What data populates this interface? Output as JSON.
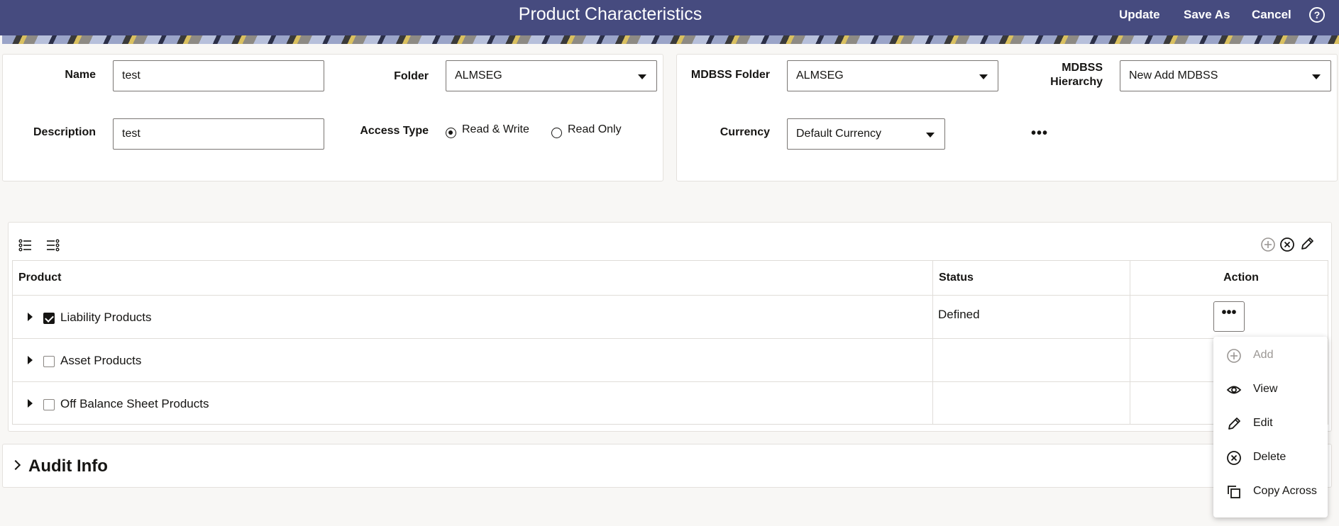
{
  "header": {
    "title": "Product Characteristics",
    "update_label": "Update",
    "save_as_label": "Save As",
    "cancel_label": "Cancel",
    "help_symbol": "?"
  },
  "left_panel": {
    "name_label": "Name",
    "name_value": "test",
    "folder_label": "Folder",
    "folder_value": "ALMSEG",
    "description_label": "Description",
    "description_value": "test",
    "access_type_label": "Access Type",
    "access_options": [
      "Read & Write",
      "Read Only"
    ],
    "access_selected": "Read & Write"
  },
  "right_panel": {
    "mdbss_folder_label": "MDBSS Folder",
    "mdbss_folder_value": "ALMSEG",
    "mdbss_hierarchy_label_line1": "MDBSS",
    "mdbss_hierarchy_label_line2": "Hierarchy",
    "mdbss_hierarchy_value": "New Add MDBSS",
    "currency_label": "Currency",
    "currency_value": "Default Currency",
    "more_symbol": "•••"
  },
  "grid": {
    "columns": [
      "Product",
      "Status",
      "Action"
    ],
    "rows": [
      {
        "product": "Liability Products",
        "checked": true,
        "status": "Defined"
      },
      {
        "product": "Asset Products",
        "checked": false,
        "status": ""
      },
      {
        "product": "Off Balance Sheet Products",
        "checked": false,
        "status": ""
      }
    ],
    "action_symbol": "•••"
  },
  "action_menu": {
    "items": [
      {
        "label": "Add",
        "icon": "plus-circle-icon",
        "enabled": false
      },
      {
        "label": "View",
        "icon": "eye-icon",
        "enabled": true
      },
      {
        "label": "Edit",
        "icon": "pencil-icon",
        "enabled": true
      },
      {
        "label": "Delete",
        "icon": "x-circle-icon",
        "enabled": true
      },
      {
        "label": "Copy Across",
        "icon": "copy-icon",
        "enabled": true
      }
    ]
  },
  "audit": {
    "title": "Audit Info"
  },
  "colors": {
    "header_bg": "#464b7f",
    "page_bg": "#f8f7f5",
    "text": "#161513",
    "disabled_text": "#9b9794"
  }
}
